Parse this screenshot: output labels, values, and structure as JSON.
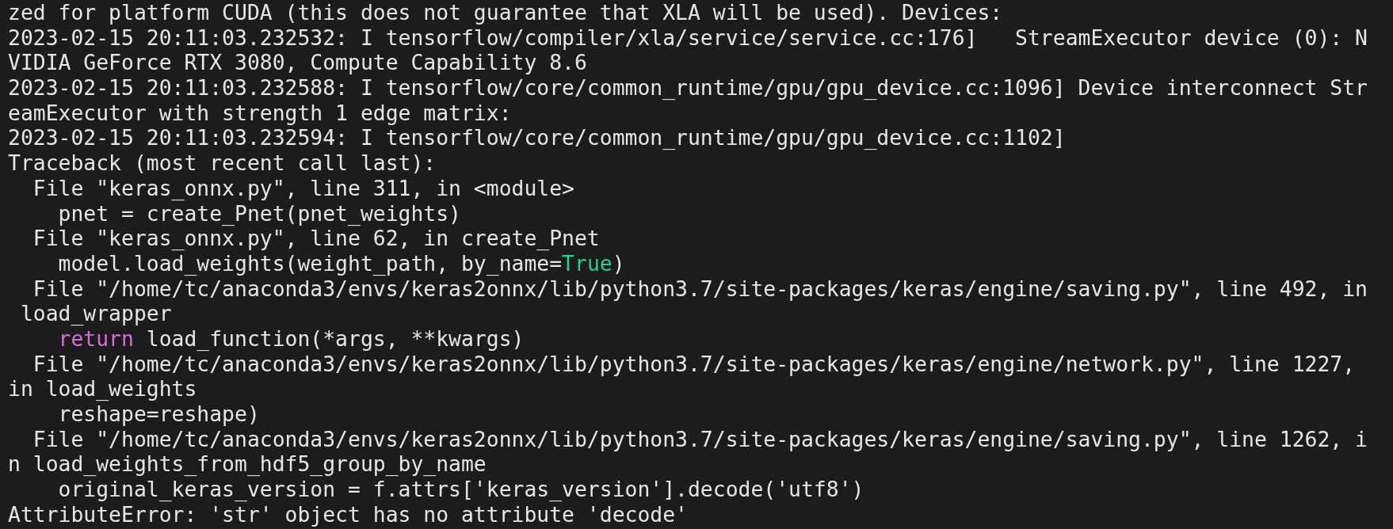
{
  "terminal": {
    "lines": [
      [
        {
          "kind": "plain",
          "text": "zed for platform CUDA (this does not guarantee that XLA will be used). Devices:"
        }
      ],
      [
        {
          "kind": "plain",
          "text": "2023-02-15 20:11:03.232532: I tensorflow/compiler/xla/service/service.cc:176]   StreamExecutor device (0): N"
        }
      ],
      [
        {
          "kind": "plain",
          "text": "VIDIA GeForce RTX 3080, Compute Capability 8.6"
        }
      ],
      [
        {
          "kind": "plain",
          "text": "2023-02-15 20:11:03.232588: I tensorflow/core/common_runtime/gpu/gpu_device.cc:1096] Device interconnect Str"
        }
      ],
      [
        {
          "kind": "plain",
          "text": "eamExecutor with strength 1 edge matrix:"
        }
      ],
      [
        {
          "kind": "plain",
          "text": "2023-02-15 20:11:03.232594: I tensorflow/core/common_runtime/gpu/gpu_device.cc:1102]"
        }
      ],
      [
        {
          "kind": "plain",
          "text": "Traceback (most recent call last):"
        }
      ],
      [
        {
          "kind": "plain",
          "text": "  File \"keras_onnx.py\", line 311, in <module>"
        }
      ],
      [
        {
          "kind": "plain",
          "text": "    pnet = create_Pnet(pnet_weights)"
        }
      ],
      [
        {
          "kind": "plain",
          "text": "  File \"keras_onnx.py\", line 62, in create_Pnet"
        }
      ],
      [
        {
          "kind": "plain",
          "text": "    model.load_weights(weight_path, by_name="
        },
        {
          "kind": "constant",
          "text": "True"
        },
        {
          "kind": "plain",
          "text": ")"
        }
      ],
      [
        {
          "kind": "plain",
          "text": "  File \"/home/tc/anaconda3/envs/keras2onnx/lib/python3.7/site-packages/keras/engine/saving.py\", line 492, in"
        }
      ],
      [
        {
          "kind": "plain",
          "text": " load_wrapper"
        }
      ],
      [
        {
          "kind": "keyword",
          "text": "    return"
        },
        {
          "kind": "plain",
          "text": " load_function(*args, **kwargs)"
        }
      ],
      [
        {
          "kind": "plain",
          "text": "  File \"/home/tc/anaconda3/envs/keras2onnx/lib/python3.7/site-packages/keras/engine/network.py\", line 1227,"
        }
      ],
      [
        {
          "kind": "plain",
          "text": "in load_weights"
        }
      ],
      [
        {
          "kind": "plain",
          "text": "    reshape=reshape)"
        }
      ],
      [
        {
          "kind": "plain",
          "text": "  File \"/home/tc/anaconda3/envs/keras2onnx/lib/python3.7/site-packages/keras/engine/saving.py\", line 1262, i"
        }
      ],
      [
        {
          "kind": "plain",
          "text": "n load_weights_from_hdf5_group_by_name"
        }
      ],
      [
        {
          "kind": "plain",
          "text": "    original_keras_version = f.attrs['keras_version'].decode('utf8')"
        }
      ],
      [
        {
          "kind": "plain",
          "text": "AttributeError: 'str' object has no attribute 'decode'"
        }
      ]
    ]
  }
}
